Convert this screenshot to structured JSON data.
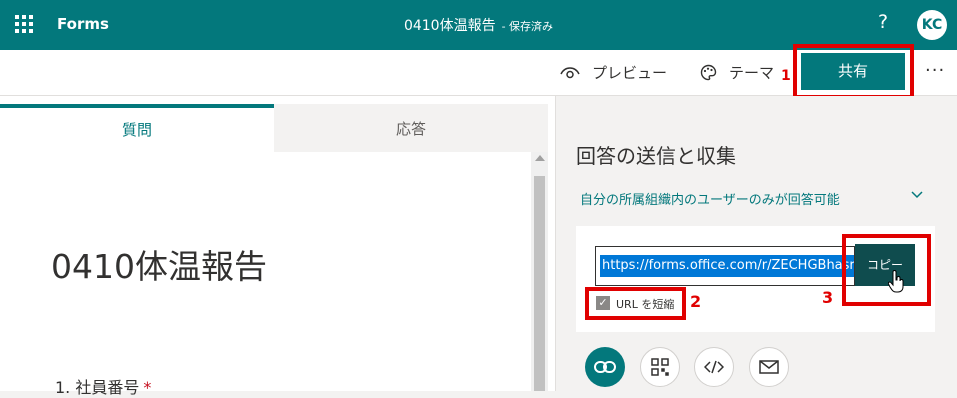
{
  "header": {
    "app_name": "Forms",
    "doc_title": "0410体温報告",
    "save_status": "- 保存済み",
    "help": "?",
    "avatar_initials": "KC"
  },
  "toolbar": {
    "preview_label": "プレビュー",
    "theme_label": "テーマ",
    "share_label": "共有",
    "more": "···"
  },
  "tabs": [
    {
      "label": "質問",
      "active": true
    },
    {
      "label": "応答",
      "active": false
    }
  ],
  "form": {
    "title": "0410体温報告",
    "question_1": "1. 社員番号",
    "required_mark": "*"
  },
  "share_panel": {
    "title": "回答の送信と収集",
    "audience": "自分の所属組織内のユーザーのみが回答可能",
    "url": "https://forms.office.com/r/ZECHGBhasr",
    "copy_label": "コピー",
    "shorten_label": "URL を短縮",
    "shorten_checked": true,
    "methods": [
      "link-icon",
      "qr-code-icon",
      "embed-code-icon",
      "email-icon"
    ]
  },
  "annotations": {
    "step_1": "1",
    "step_2": "2",
    "step_3": "3",
    "color": "#e00000"
  },
  "colors": {
    "brand": "#03787c",
    "copy_button": "#0f4c4e",
    "selection": "#0078d7"
  }
}
